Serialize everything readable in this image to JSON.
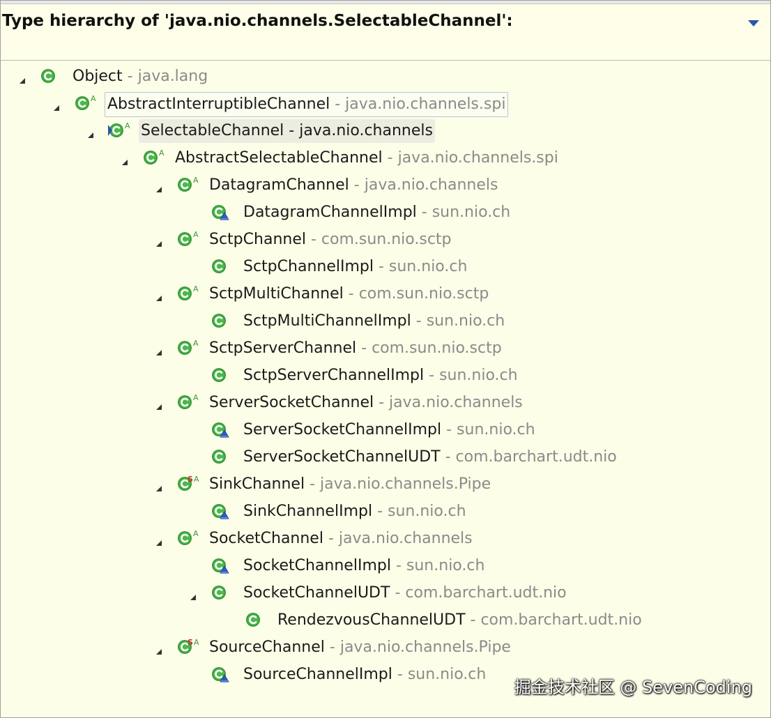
{
  "header": {
    "title": "Type hierarchy of 'java.nio.channels.SelectableChannel':",
    "menu_icon": "view-menu-icon"
  },
  "tree": [
    {
      "level": 0,
      "expanded": true,
      "icon": "class",
      "abstract": false,
      "static": false,
      "impl": false,
      "name": "Object",
      "sep": " - ",
      "pkg": "java.lang"
    },
    {
      "level": 1,
      "expanded": true,
      "icon": "class",
      "abstract": true,
      "static": false,
      "impl": false,
      "name": "AbstractInterruptibleChannel",
      "sep": " - ",
      "pkg": "java.nio.channels.spi",
      "style": "selected"
    },
    {
      "level": 2,
      "expanded": true,
      "icon": "class",
      "abstract": true,
      "static": false,
      "impl": false,
      "focus": true,
      "name": "SelectableChannel",
      "sep": " - ",
      "pkg": "java.nio.channels",
      "style": "focus"
    },
    {
      "level": 3,
      "expanded": true,
      "icon": "class",
      "abstract": true,
      "static": false,
      "impl": false,
      "name": "AbstractSelectableChannel",
      "sep": " - ",
      "pkg": "java.nio.channels.spi"
    },
    {
      "level": 4,
      "expanded": true,
      "icon": "class",
      "abstract": true,
      "static": false,
      "impl": false,
      "name": "DatagramChannel",
      "sep": " - ",
      "pkg": "java.nio.channels"
    },
    {
      "level": 5,
      "expanded": false,
      "leaf": true,
      "icon": "class",
      "abstract": false,
      "static": false,
      "impl": true,
      "name": "DatagramChannelImpl",
      "sep": " - ",
      "pkg": "sun.nio.ch"
    },
    {
      "level": 4,
      "expanded": true,
      "icon": "class",
      "abstract": true,
      "static": false,
      "impl": false,
      "name": "SctpChannel",
      "sep": " - ",
      "pkg": "com.sun.nio.sctp"
    },
    {
      "level": 5,
      "expanded": false,
      "leaf": true,
      "icon": "class",
      "abstract": false,
      "static": false,
      "impl": false,
      "name": "SctpChannelImpl",
      "sep": " - ",
      "pkg": "sun.nio.ch"
    },
    {
      "level": 4,
      "expanded": true,
      "icon": "class",
      "abstract": true,
      "static": false,
      "impl": false,
      "name": "SctpMultiChannel",
      "sep": " - ",
      "pkg": "com.sun.nio.sctp"
    },
    {
      "level": 5,
      "expanded": false,
      "leaf": true,
      "icon": "class",
      "abstract": false,
      "static": false,
      "impl": false,
      "name": "SctpMultiChannelImpl",
      "sep": " - ",
      "pkg": "sun.nio.ch"
    },
    {
      "level": 4,
      "expanded": true,
      "icon": "class",
      "abstract": true,
      "static": false,
      "impl": false,
      "name": "SctpServerChannel",
      "sep": " - ",
      "pkg": "com.sun.nio.sctp"
    },
    {
      "level": 5,
      "expanded": false,
      "leaf": true,
      "icon": "class",
      "abstract": false,
      "static": false,
      "impl": false,
      "name": "SctpServerChannelImpl",
      "sep": " - ",
      "pkg": "sun.nio.ch"
    },
    {
      "level": 4,
      "expanded": true,
      "icon": "class",
      "abstract": true,
      "static": false,
      "impl": false,
      "name": "ServerSocketChannel",
      "sep": " - ",
      "pkg": "java.nio.channels"
    },
    {
      "level": 5,
      "expanded": false,
      "leaf": true,
      "icon": "class",
      "abstract": false,
      "static": false,
      "impl": true,
      "name": "ServerSocketChannelImpl",
      "sep": " - ",
      "pkg": "sun.nio.ch"
    },
    {
      "level": 5,
      "expanded": false,
      "leaf": true,
      "icon": "class",
      "abstract": false,
      "static": false,
      "impl": false,
      "name": "ServerSocketChannelUDT",
      "sep": " - ",
      "pkg": "com.barchart.udt.nio"
    },
    {
      "level": 4,
      "expanded": true,
      "icon": "class",
      "abstract": true,
      "static": true,
      "impl": false,
      "name": "SinkChannel",
      "sep": " - ",
      "pkg": "java.nio.channels.Pipe"
    },
    {
      "level": 5,
      "expanded": false,
      "leaf": true,
      "icon": "class",
      "abstract": false,
      "static": false,
      "impl": true,
      "name": "SinkChannelImpl",
      "sep": " - ",
      "pkg": "sun.nio.ch"
    },
    {
      "level": 4,
      "expanded": true,
      "icon": "class",
      "abstract": true,
      "static": false,
      "impl": false,
      "name": "SocketChannel",
      "sep": " - ",
      "pkg": "java.nio.channels"
    },
    {
      "level": 5,
      "expanded": false,
      "leaf": true,
      "icon": "class",
      "abstract": false,
      "static": false,
      "impl": true,
      "name": "SocketChannelImpl",
      "sep": " - ",
      "pkg": "sun.nio.ch"
    },
    {
      "level": 5,
      "expanded": true,
      "icon": "class",
      "abstract": false,
      "static": false,
      "impl": false,
      "name": "SocketChannelUDT",
      "sep": " - ",
      "pkg": "com.barchart.udt.nio"
    },
    {
      "level": 6,
      "expanded": false,
      "leaf": true,
      "icon": "class",
      "abstract": false,
      "static": false,
      "impl": false,
      "name": "RendezvousChannelUDT",
      "sep": " - ",
      "pkg": "com.barchart.udt.nio"
    },
    {
      "level": 4,
      "expanded": true,
      "icon": "class",
      "abstract": true,
      "static": true,
      "impl": false,
      "name": "SourceChannel",
      "sep": " - ",
      "pkg": "java.nio.channels.Pipe"
    },
    {
      "level": 5,
      "expanded": false,
      "leaf": true,
      "icon": "class",
      "abstract": false,
      "static": false,
      "impl": true,
      "name": "SourceChannelImpl",
      "sep": " - ",
      "pkg": "sun.nio.ch"
    }
  ],
  "watermark": "掘金技术社区 @ SevenCoding",
  "colors": {
    "background": "#fdfee8",
    "class_icon_green": "#3a9a3a",
    "abstract_marker_green": "#3a9a3a",
    "static_marker_red": "#c0282a",
    "impl_overlay_blue": "#2a5fc0",
    "package_gray": "#8a8a8a",
    "twisty": "#333333"
  }
}
